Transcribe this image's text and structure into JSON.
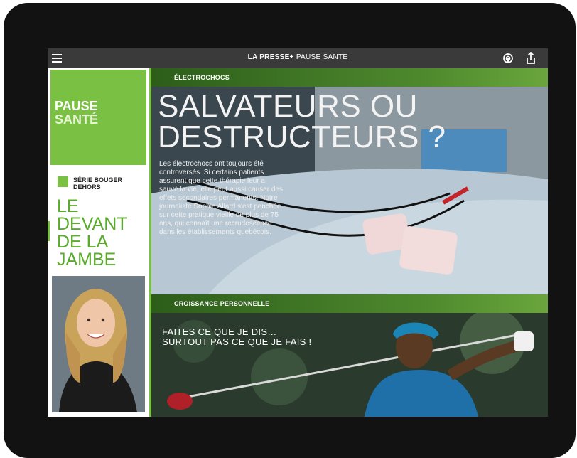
{
  "header": {
    "brand_part1": "LA PRESSE",
    "brand_plus": "+",
    "brand_section": "PAUSE SANTÉ",
    "menu_icon": "hamburger-menu-icon",
    "podcast_icon": "podcast-icon",
    "share_icon": "share-icon"
  },
  "sidebar": {
    "section_title_line1": "PAUSE",
    "section_title_line2": "SANTÉ",
    "series_label": "SÉRIE BOUGER DEHORS",
    "article_title": "LE DEVANT DE LA JAMBE"
  },
  "stories": [
    {
      "category": "ÉLECTROCHOCS",
      "headline": "SALVATEURS OU DESTRUCTEURS ?",
      "excerpt": "Les électrochocs ont toujours été controversés. Si certains patients assurent que cette thérapie leur a sauvé la vie, elle peut aussi causer des effets secondaires permanents. Notre journaliste Sophie Allard s'est penchée sur cette pratique vieille de plus de 75 ans, qui connaît une recrudescence dans les établissements québécois."
    },
    {
      "category": "CROISSANCE PERSONNELLE",
      "headline_line1": "FAITES CE QUE JE DIS…",
      "headline_line2": "SURTOUT PAS CE QUE JE FAIS !"
    }
  ],
  "colors": {
    "accent_green": "#7ac143",
    "topbar": "#3a3a3a",
    "title_green": "#5aab2b"
  }
}
